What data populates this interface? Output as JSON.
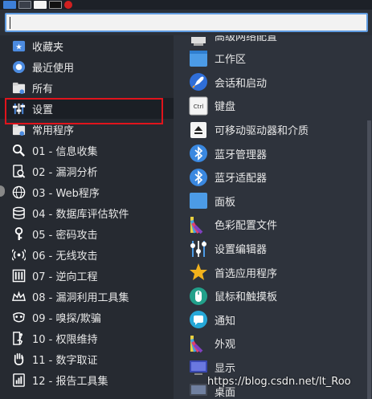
{
  "search": {
    "value": "",
    "placeholder": ""
  },
  "categories": [
    {
      "label": "收藏夹",
      "icon": "star-icon"
    },
    {
      "label": "最近使用",
      "icon": "clock-icon"
    },
    {
      "label": "所有",
      "icon": "folder-icon"
    },
    {
      "label": "设置",
      "icon": "settings-sliders-icon"
    },
    {
      "label": "常用程序",
      "icon": "folder-icon"
    },
    {
      "label": "01 - 信息收集",
      "icon": "magnifier-icon"
    },
    {
      "label": "02 - 漏洞分析",
      "icon": "search-doc-icon"
    },
    {
      "label": "03 - Web程序",
      "icon": "globe-icon"
    },
    {
      "label": "04 - 数据库评估软件",
      "icon": "database-icon"
    },
    {
      "label": "05 - 密码攻击",
      "icon": "key-icon"
    },
    {
      "label": "06 - 无线攻击",
      "icon": "wireless-icon"
    },
    {
      "label": "07 - 逆向工程",
      "icon": "chip-icon"
    },
    {
      "label": "08 - 漏洞利用工具集",
      "icon": "crown-icon"
    },
    {
      "label": "09 - 嗅探/欺骗",
      "icon": "mask-icon"
    },
    {
      "label": "10 - 权限维持",
      "icon": "runner-icon"
    },
    {
      "label": "11 - 数字取证",
      "icon": "hand-icon"
    },
    {
      "label": "12 - 报告工具集",
      "icon": "report-icon"
    }
  ],
  "apps": [
    {
      "label": "高级网络配置",
      "icon": "network-icon"
    },
    {
      "label": "工作区",
      "icon": "workspace-icon"
    },
    {
      "label": "会话和启动",
      "icon": "rocket-icon"
    },
    {
      "label": "键盘",
      "icon": "keyboard-icon"
    },
    {
      "label": "可移动驱动器和介质",
      "icon": "eject-icon"
    },
    {
      "label": "蓝牙管理器",
      "icon": "bluetooth-icon"
    },
    {
      "label": "蓝牙适配器",
      "icon": "bluetooth-icon"
    },
    {
      "label": "面板",
      "icon": "panel-icon"
    },
    {
      "label": "色彩配置文件",
      "icon": "color-profile-icon"
    },
    {
      "label": "设置编辑器",
      "icon": "settings-editor-icon"
    },
    {
      "label": "首选应用程序",
      "icon": "star-icon"
    },
    {
      "label": "鼠标和触摸板",
      "icon": "mouse-icon"
    },
    {
      "label": "通知",
      "icon": "notification-icon"
    },
    {
      "label": "外观",
      "icon": "appearance-icon"
    },
    {
      "label": "显示",
      "icon": "display-icon"
    },
    {
      "label": "桌面",
      "icon": "desktop-icon"
    }
  ],
  "keyboard_icon_text": "Ctrl",
  "watermark": "https://blog.csdn.net/lt_Roo"
}
